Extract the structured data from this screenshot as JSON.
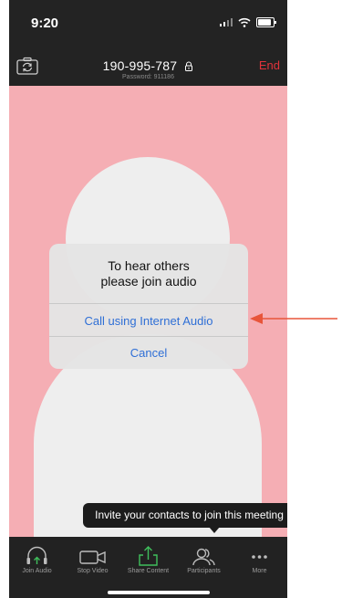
{
  "status_bar": {
    "time": "9:20"
  },
  "meeting": {
    "id": "190-995-787",
    "password": "Password: 911186",
    "end_label": "End"
  },
  "dialog": {
    "title_line1": "To hear others",
    "title_line2": "please join audio",
    "primary_option": "Call using Internet Audio",
    "cancel_option": "Cancel"
  },
  "tooltip": {
    "text": "Invite your contacts to join this meeting"
  },
  "toolbar": {
    "items": [
      {
        "label": "Join Audio",
        "icon": "headphones-icon"
      },
      {
        "label": "Stop Video",
        "icon": "video-camera-icon"
      },
      {
        "label": "Share Content",
        "icon": "share-upload-icon"
      },
      {
        "label": "Participants",
        "icon": "participants-icon"
      },
      {
        "label": "More",
        "icon": "more-dots-icon"
      }
    ]
  },
  "colors": {
    "accent_blue": "#2f6fd6",
    "end_red": "#e0333b",
    "video_background": "#f5aeb4",
    "annotation_arrow": "#e8553a",
    "share_green": "#3fbf5c"
  }
}
